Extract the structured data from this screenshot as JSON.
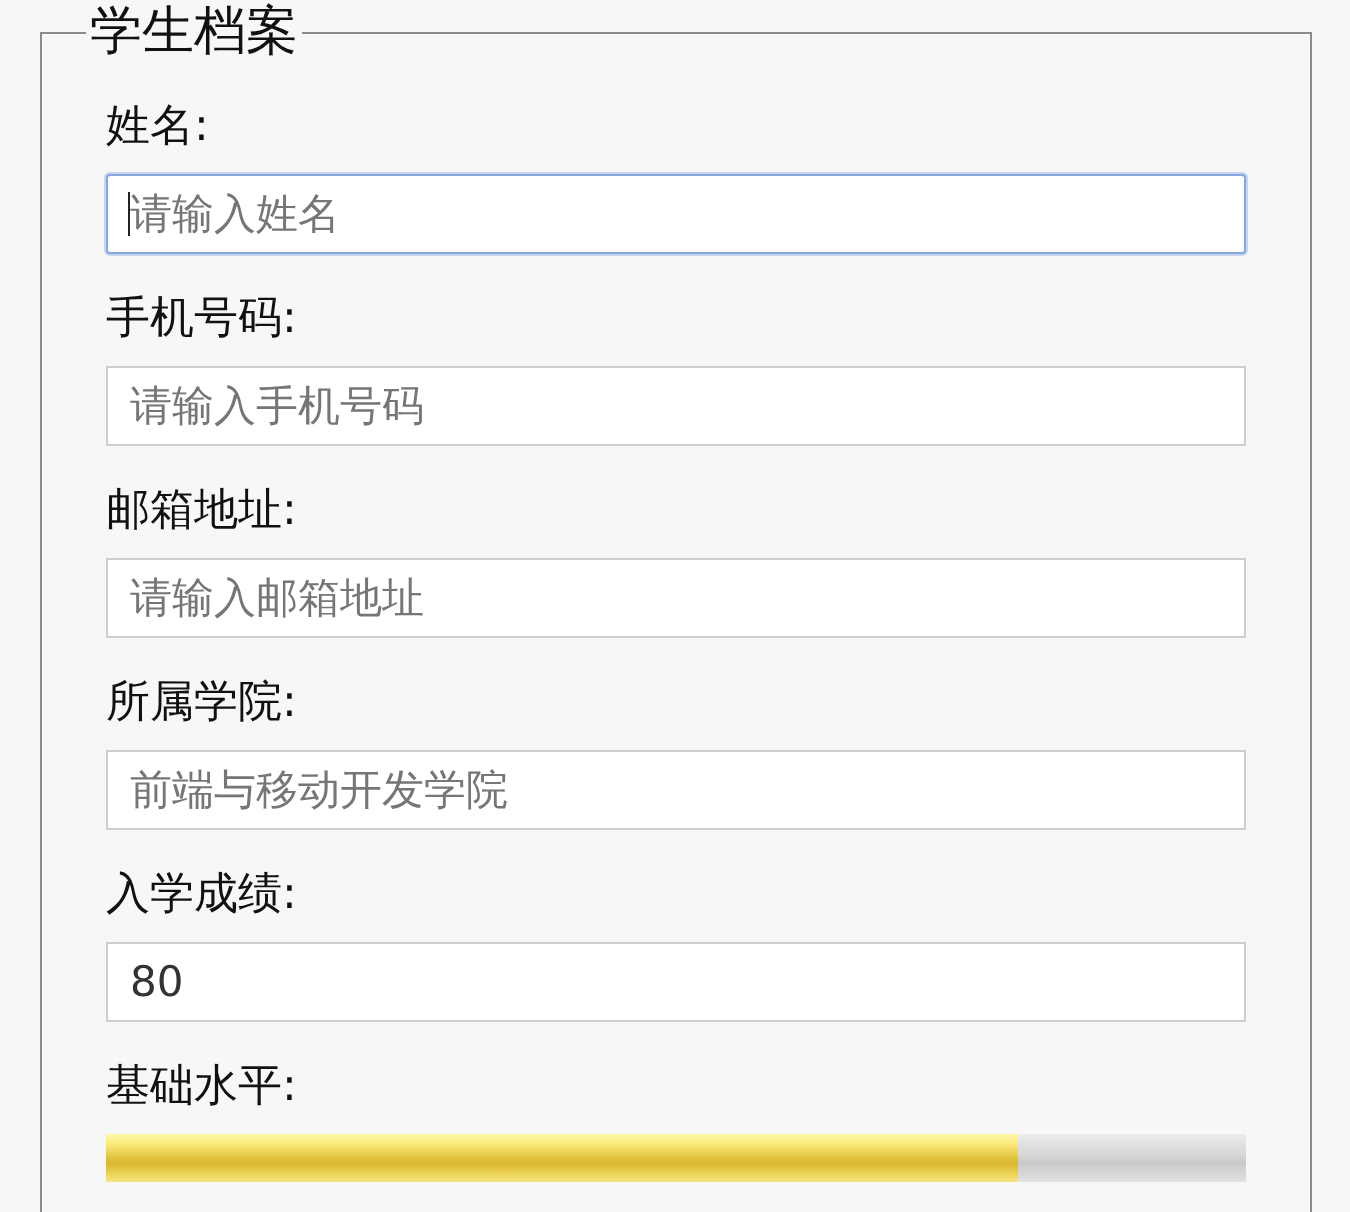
{
  "fieldset": {
    "legend": "学生档案"
  },
  "fields": [
    {
      "kind": "text",
      "label": "姓名:",
      "placeholder": "请输入姓名",
      "focused": true
    },
    {
      "kind": "text",
      "label": "手机号码:",
      "placeholder": "请输入手机号码",
      "focused": false
    },
    {
      "kind": "text",
      "label": "邮箱地址:",
      "placeholder": "请输入邮箱地址",
      "focused": false
    },
    {
      "kind": "text",
      "label": "所属学院:",
      "placeholder": "前端与移动开发学院",
      "focused": false
    },
    {
      "kind": "text",
      "label": "入学成绩:",
      "value": "80",
      "focused": false
    },
    {
      "kind": "meter",
      "label": "基础水平:",
      "level": 0.8
    }
  ]
}
